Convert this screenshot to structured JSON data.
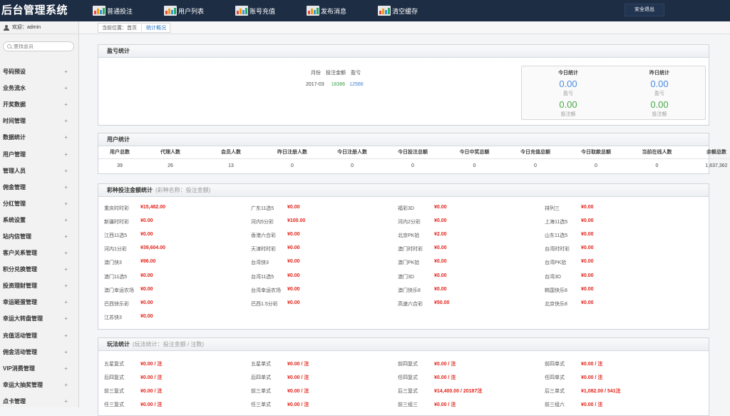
{
  "app": {
    "title": "后台管理系统"
  },
  "topnav": [
    {
      "label": "普通投注",
      "icon": "chart-icon"
    },
    {
      "label": "用户列表",
      "icon": "chart-icon"
    },
    {
      "label": "账号充值",
      "icon": "chart-icon"
    },
    {
      "label": "发布消息",
      "icon": "chart-icon"
    },
    {
      "label": "清空缓存",
      "icon": "chart-icon"
    }
  ],
  "header": {
    "logout_label": "安全退出"
  },
  "sidebar": {
    "welcome": "欢迎：admin",
    "search_placeholder": "查找会员",
    "items": [
      {
        "label": "号码预设"
      },
      {
        "label": "业务流水"
      },
      {
        "label": "开奖数据"
      },
      {
        "label": "时间管理"
      },
      {
        "label": "数据统计"
      },
      {
        "label": "用户管理"
      },
      {
        "label": "管理人员"
      },
      {
        "label": "佣金管理"
      },
      {
        "label": "分红管理"
      },
      {
        "label": "系统设置"
      },
      {
        "label": "站内信管理"
      },
      {
        "label": "客户关系管理"
      },
      {
        "label": "积分兑换管理"
      },
      {
        "label": "投资理财管理"
      },
      {
        "label": "幸运砸蛋管理"
      },
      {
        "label": "幸运大转盘管理"
      },
      {
        "label": "充值活动管理"
      },
      {
        "label": "佣金活动管理"
      },
      {
        "label": "VIP消费管理"
      },
      {
        "label": "幸运大抽奖管理"
      },
      {
        "label": "点卡管理"
      }
    ],
    "plus": "+"
  },
  "breadcrumb": {
    "prefix": "当前位置：",
    "home": "首页",
    "current": "统计概况"
  },
  "profit": {
    "title": "盈亏统计",
    "headers": [
      "月份",
      "投注金额",
      "盈亏"
    ],
    "row": {
      "month": "2017-03",
      "bet": "18386",
      "profit": "12566"
    },
    "today": {
      "label": "今日统计",
      "profit": "0.00",
      "profit_caption": "盈亏",
      "bet": "0.00",
      "bet_caption": "投注额"
    },
    "yesterday": {
      "label": "昨日统计",
      "profit": "0.00",
      "profit_caption": "盈亏",
      "bet": "0.00",
      "bet_caption": "投注额"
    }
  },
  "users": {
    "title": "用户统计",
    "headers": [
      "用户总数",
      "代理人数",
      "会员人数",
      "昨日注册人数",
      "今日注册人数",
      "今日投注总额",
      "今日中奖总额",
      "今日充值总额",
      "今日取款总额",
      "当前在线人数",
      "余额总数"
    ],
    "values": [
      "39",
      "26",
      "13",
      "0",
      "0",
      "0",
      "0",
      "0",
      "0",
      "0",
      "1,637,362"
    ]
  },
  "lottery": {
    "title": "彩种投注金额统计",
    "subtitle": "(彩种名称：投注金额)",
    "rows": [
      [
        {
          "n": "重庆时时彩",
          "v": "¥15,482.00"
        },
        {
          "n": "广东11选5",
          "v": "¥0.00"
        },
        {
          "n": "福彩3D",
          "v": "¥0.00"
        },
        {
          "n": "排列三",
          "v": "¥0.00"
        }
      ],
      [
        {
          "n": "新疆时时彩",
          "v": "¥0.00"
        },
        {
          "n": "河内5分彩",
          "v": "¥100.00"
        },
        {
          "n": "河内2分彩",
          "v": "¥0.00"
        },
        {
          "n": "上海11选5",
          "v": "¥0.00"
        }
      ],
      [
        {
          "n": "江西11选5",
          "v": "¥0.00"
        },
        {
          "n": "香港六合彩",
          "v": "¥0.00"
        },
        {
          "n": "北京PK拾",
          "v": "¥2.00"
        },
        {
          "n": "山东11选5",
          "v": "¥0.00"
        }
      ],
      [
        {
          "n": "河内1分彩",
          "v": "¥39,604.00"
        },
        {
          "n": "天津时时彩",
          "v": "¥0.00"
        },
        {
          "n": "澳门时时彩",
          "v": "¥0.00"
        },
        {
          "n": "台湾时时彩",
          "v": "¥0.00"
        }
      ],
      [
        {
          "n": "澳门快3",
          "v": "¥96.00"
        },
        {
          "n": "台湾快3",
          "v": "¥0.00"
        },
        {
          "n": "澳门PK拾",
          "v": "¥0.00"
        },
        {
          "n": "台湾PK拾",
          "v": "¥0.00"
        }
      ],
      [
        {
          "n": "澳门11选5",
          "v": "¥0.00"
        },
        {
          "n": "台湾11选5",
          "v": "¥0.00"
        },
        {
          "n": "澳门3D",
          "v": "¥0.00"
        },
        {
          "n": "台湾3D",
          "v": "¥0.00"
        }
      ],
      [
        {
          "n": "澳门幸运农场",
          "v": "¥0.00"
        },
        {
          "n": "台湾幸运农场",
          "v": "¥0.00"
        },
        {
          "n": "澳门快乐8",
          "v": "¥0.00"
        },
        {
          "n": "韩国快乐8",
          "v": "¥0.00"
        }
      ],
      [
        {
          "n": "巴西快乐彩",
          "v": "¥0.00"
        },
        {
          "n": "巴西1.5分彩",
          "v": "¥0.00"
        },
        {
          "n": "高速六合彩",
          "v": "¥50.00"
        },
        {
          "n": "北京快乐8",
          "v": "¥0.00"
        }
      ],
      [
        {
          "n": "江苏快3",
          "v": "¥0.00"
        }
      ]
    ]
  },
  "plays": {
    "title": "玩法统计",
    "subtitle": "(玩法统计：投注金额 / 注数)",
    "rows": [
      [
        {
          "n": "五星复式",
          "v": "¥0.00 / 注"
        },
        {
          "n": "五星单式",
          "v": "¥0.00 / 注"
        },
        {
          "n": "前四复式",
          "v": "¥0.00 / 注"
        },
        {
          "n": "前四单式",
          "v": "¥0.00 / 注"
        }
      ],
      [
        {
          "n": "后四复式",
          "v": "¥0.00 / 注"
        },
        {
          "n": "后四单式",
          "v": "¥0.00 / 注"
        },
        {
          "n": "任四复式",
          "v": "¥0.00 / 注"
        },
        {
          "n": "任四单式",
          "v": "¥0.00 / 注"
        }
      ],
      [
        {
          "n": "前三复式",
          "v": "¥0.00 / 注"
        },
        {
          "n": "前三单式",
          "v": "¥0.00 / 注"
        },
        {
          "n": "后三复式",
          "v": "¥14,400.00 / 20187注"
        },
        {
          "n": "后三单式",
          "v": "¥1,082.00 / 541注"
        }
      ],
      [
        {
          "n": "任三复式",
          "v": "¥0.00 / 注"
        },
        {
          "n": "任三单式",
          "v": "¥0.00 / 注"
        },
        {
          "n": "前三组三",
          "v": "¥0.00 / 注"
        },
        {
          "n": "前三组六",
          "v": "¥0.00 / 注"
        }
      ]
    ]
  },
  "colors": {
    "header_bg": "#1d2d44",
    "amount_red": "#e2231a",
    "stat_blue": "#4a8be0",
    "stat_green": "#48a948"
  }
}
